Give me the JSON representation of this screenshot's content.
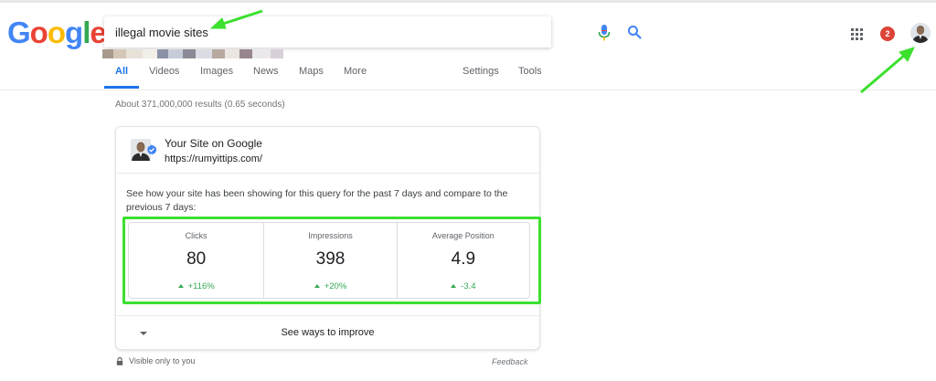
{
  "logo": {
    "letters": [
      "G",
      "o",
      "o",
      "g",
      "l",
      "e"
    ]
  },
  "search": {
    "value": "illegal movie sites"
  },
  "tabs": [
    {
      "label": "All",
      "active": true
    },
    {
      "label": "Videos"
    },
    {
      "label": "Images"
    },
    {
      "label": "News"
    },
    {
      "label": "Maps"
    },
    {
      "label": "More"
    },
    {
      "label": "Settings"
    },
    {
      "label": "Tools"
    }
  ],
  "header": {
    "notification_count": "2"
  },
  "result_stats": "About 371,000,000 results (0.65 seconds)",
  "card": {
    "title": "Your Site on Google",
    "url": "https://rumyittips.com/",
    "description": "See how your site has been showing for this query for the past 7 days and compare to the previous 7 days:",
    "stats": [
      {
        "label": "Clicks",
        "value": "80",
        "change": "+116%"
      },
      {
        "label": "Impressions",
        "value": "398",
        "change": "+20%"
      },
      {
        "label": "Average Position",
        "value": "4.9",
        "change": "-3.4"
      }
    ],
    "improve_label": "See ways to improve"
  },
  "footer": {
    "visible_only": "Visible only to you",
    "feedback": "Feedback"
  },
  "colors": {
    "accent": "#1a73e8",
    "positive": "#34a853",
    "annotation": "#3ce02f",
    "badge": "#db4437"
  }
}
